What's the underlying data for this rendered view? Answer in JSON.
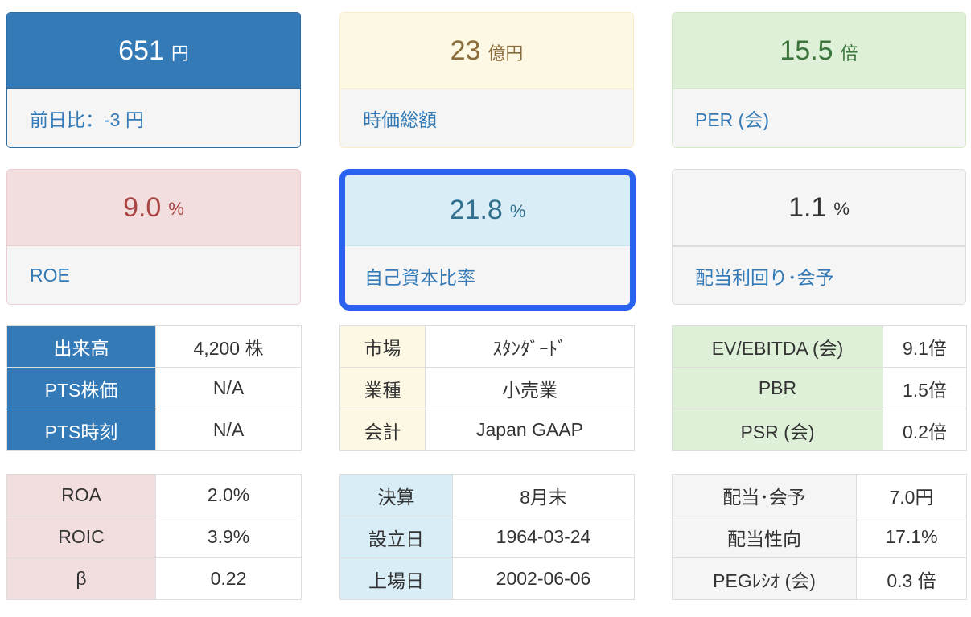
{
  "cards": {
    "price": {
      "value": "651",
      "unit": "円",
      "label": "前日比：-3 円"
    },
    "market_cap": {
      "value": "23",
      "unit": "億円",
      "label": "時価総額"
    },
    "per": {
      "value": "15.5",
      "unit": "倍",
      "label": "PER (会)"
    },
    "roe": {
      "value": "9.0",
      "unit": "%",
      "label": "ROE"
    },
    "equity_ratio": {
      "value": "21.8",
      "unit": "%",
      "label": "自己資本比率"
    },
    "dividend_yield": {
      "value": "1.1",
      "unit": "%",
      "label": "配当利回り･会予"
    }
  },
  "trading_table": {
    "rows": [
      {
        "label": "出来高",
        "value": "4,200 株"
      },
      {
        "label": "PTS株価",
        "value": "N/A"
      },
      {
        "label": "PTS時刻",
        "value": "N/A"
      }
    ]
  },
  "market_table": {
    "rows": [
      {
        "label": "市場",
        "value": "ｽﾀﾝﾀﾞｰﾄﾞ"
      },
      {
        "label": "業種",
        "value": "小売業"
      },
      {
        "label": "会計",
        "value": "Japan GAAP"
      }
    ]
  },
  "valuation_table": {
    "rows": [
      {
        "label": "EV/EBITDA (会)",
        "value": "9.1倍"
      },
      {
        "label": "PBR",
        "value": "1.5倍"
      },
      {
        "label": "PSR (会)",
        "value": "0.2倍"
      }
    ]
  },
  "return_table": {
    "rows": [
      {
        "label": "ROA",
        "value": "2.0%"
      },
      {
        "label": "ROIC",
        "value": "3.9%"
      },
      {
        "label": "β",
        "value": "0.22"
      }
    ]
  },
  "company_table": {
    "rows": [
      {
        "label": "決算",
        "value": "8月末"
      },
      {
        "label": "設立日",
        "value": "1964-03-24"
      },
      {
        "label": "上場日",
        "value": "2002-06-06"
      }
    ]
  },
  "dividend_table": {
    "rows": [
      {
        "label": "配当･会予",
        "value": "7.0円"
      },
      {
        "label": "配当性向",
        "value": "17.1%"
      },
      {
        "label": "PEGﾚｼｵ (会)",
        "value": "0.3 倍"
      }
    ]
  },
  "colors": {
    "primary": "#337ab7",
    "warning_bg": "#fcf8e3",
    "success_bg": "#dff0d8",
    "danger_bg": "#f2dede",
    "info_bg": "#d9edf7",
    "highlight_border": "#2962f0"
  }
}
